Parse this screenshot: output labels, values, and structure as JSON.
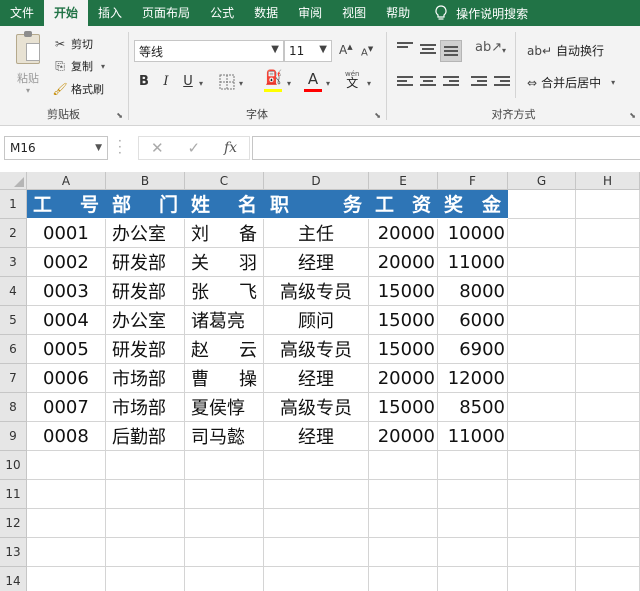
{
  "menu": {
    "tabs": [
      "文件",
      "开始",
      "插入",
      "页面布局",
      "公式",
      "数据",
      "审阅",
      "视图",
      "帮助"
    ],
    "tell_me": "操作说明搜索"
  },
  "ribbon": {
    "clipboard": {
      "paste": "粘贴",
      "cut": "剪切",
      "copy": "复制",
      "format_painter": "格式刷",
      "label": "剪贴板"
    },
    "font": {
      "name": "等线",
      "size": "11",
      "grow": "A",
      "shrink": "A",
      "bold": "B",
      "italic": "I",
      "underline": "U",
      "font_color_glyph": "A",
      "phonetic": "wén",
      "phonetic_char": "文",
      "label": "字体",
      "fill_color": "#ffff00",
      "font_color": "#ff0000"
    },
    "alignment": {
      "wrap_text": "自动换行",
      "merge_center": "合并后居中",
      "label": "对齐方式"
    }
  },
  "formula_bar": {
    "name_box": "M16",
    "cancel": "✕",
    "confirm": "✓",
    "fx": "fx",
    "value": ""
  },
  "sheet": {
    "columns": [
      "A",
      "B",
      "C",
      "D",
      "E",
      "F",
      "G",
      "H"
    ],
    "rows": [
      "1",
      "2",
      "3",
      "4",
      "5",
      "6",
      "7",
      "8",
      "9",
      "10",
      "11",
      "12",
      "13",
      "14"
    ],
    "header_row": [
      "工 号",
      "部 门",
      "姓 名",
      "职 务",
      "工 资",
      "奖 金"
    ],
    "header_fill": "#2e75b6",
    "data": [
      [
        "0001",
        "办公室",
        "刘 备",
        "主任",
        "20000",
        "10000"
      ],
      [
        "0002",
        "研发部",
        "关 羽",
        "经理",
        "20000",
        "11000"
      ],
      [
        "0003",
        "研发部",
        "张 飞",
        "高级专员",
        "15000",
        "8000"
      ],
      [
        "0004",
        "办公室",
        "诸葛亮",
        "顾问",
        "15000",
        "6000"
      ],
      [
        "0005",
        "研发部",
        "赵 云",
        "高级专员",
        "15000",
        "6900"
      ],
      [
        "0006",
        "市场部",
        "曹 操",
        "经理",
        "20000",
        "12000"
      ],
      [
        "0007",
        "市场部",
        "夏侯惇",
        "高级专员",
        "15000",
        "8500"
      ],
      [
        "0008",
        "后勤部",
        "司马懿",
        "经理",
        "20000",
        "11000"
      ]
    ]
  }
}
